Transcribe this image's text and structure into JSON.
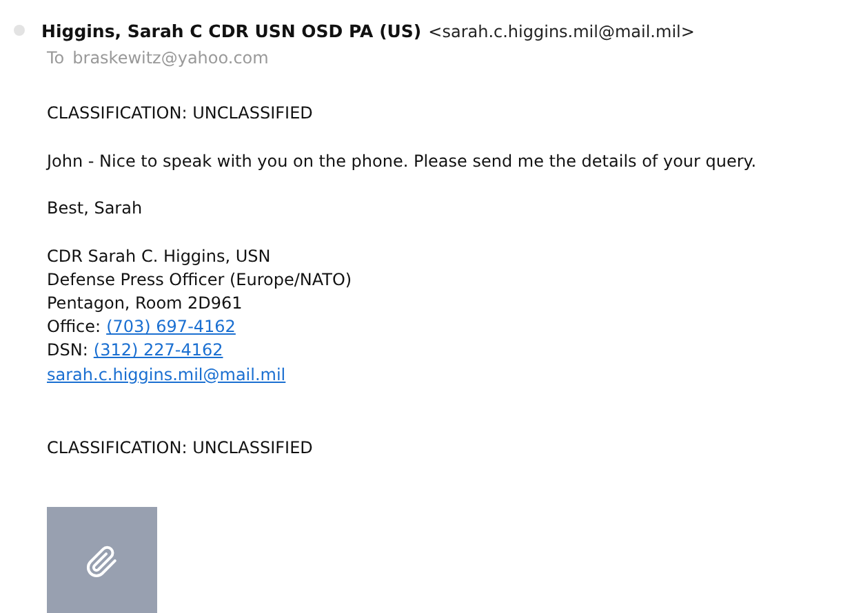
{
  "message": {
    "sender_name": "Higgins, Sarah C CDR USN OSD PA (US)",
    "sender_address": "<sarah.c.higgins.mil@mail.mil>",
    "to_label": "To",
    "recipient": "braskewitz@yahoo.com",
    "body": [
      {
        "text": "CLASSIFICATION: UNCLASSIFIED"
      },
      {
        "text": "John - Nice to speak with you on the phone. Please send me the details of your query."
      },
      {
        "text": "Best, Sarah"
      }
    ],
    "signature": [
      {
        "kind": "text",
        "text": "CDR Sarah C. Higgins, USN"
      },
      {
        "kind": "text",
        "text": "Defense Press Officer (Europe/NATO)"
      },
      {
        "kind": "text",
        "text": "Pentagon, Room 2D961"
      },
      {
        "kind": "phone",
        "label": "Office:",
        "link": "(703) 697-4162"
      },
      {
        "kind": "phone",
        "label": "DSN:",
        "link": "(312) 227-4162"
      },
      {
        "kind": "link",
        "link": "sarah.c.higgins.mil@mail.mil"
      }
    ],
    "footer": "CLASSIFICATION: UNCLASSIFIED",
    "attachments": [
      {
        "kind": "file"
      }
    ]
  }
}
